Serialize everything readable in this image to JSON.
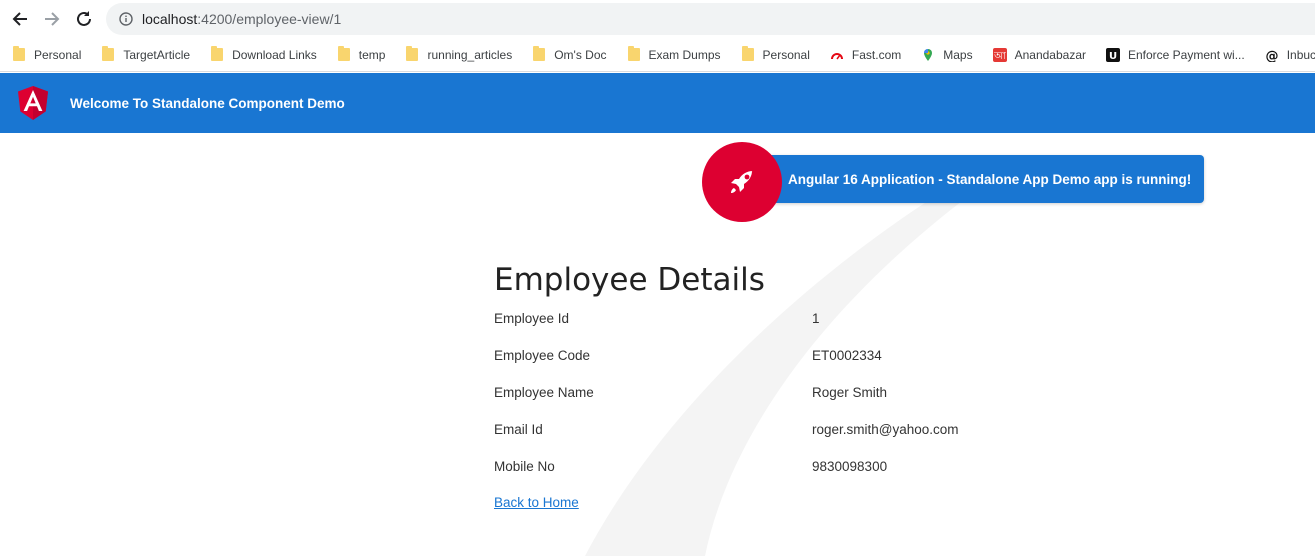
{
  "browser": {
    "url_host": "localhost",
    "url_path": ":4200/employee-view/1",
    "bookmarks": [
      {
        "label": "Personal",
        "icon": "folder-icon"
      },
      {
        "label": "TargetArticle",
        "icon": "folder-icon"
      },
      {
        "label": "Download Links",
        "icon": "folder-icon"
      },
      {
        "label": "temp",
        "icon": "folder-icon"
      },
      {
        "label": "running_articles",
        "icon": "folder-icon"
      },
      {
        "label": "Om's Doc",
        "icon": "folder-icon"
      },
      {
        "label": "Exam Dumps",
        "icon": "folder-icon"
      },
      {
        "label": "Personal",
        "icon": "folder-icon"
      },
      {
        "label": "Fast.com",
        "icon": "fast-icon"
      },
      {
        "label": "Maps",
        "icon": "maps-icon"
      },
      {
        "label": "Anandabazar",
        "icon": "anandabazar-icon"
      },
      {
        "label": "Enforce Payment wi...",
        "icon": "enforce-icon"
      },
      {
        "label": "Inbucket",
        "icon": "at-icon"
      }
    ]
  },
  "header": {
    "title": "Welcome To Standalone Component Demo",
    "brand_color": "#1976d2",
    "logo_color": "#dd0031"
  },
  "banner": {
    "text": "Angular 16 Application - Standalone App Demo app is running!"
  },
  "employee": {
    "heading": "Employee Details",
    "fields": [
      {
        "label": "Employee Id",
        "value": "1"
      },
      {
        "label": "Employee Code",
        "value": "ET0002334"
      },
      {
        "label": "Employee Name",
        "value": "Roger Smith"
      },
      {
        "label": "Email Id",
        "value": "roger.smith@yahoo.com"
      },
      {
        "label": "Mobile No",
        "value": "9830098300"
      }
    ],
    "back_link": "Back to Home"
  }
}
